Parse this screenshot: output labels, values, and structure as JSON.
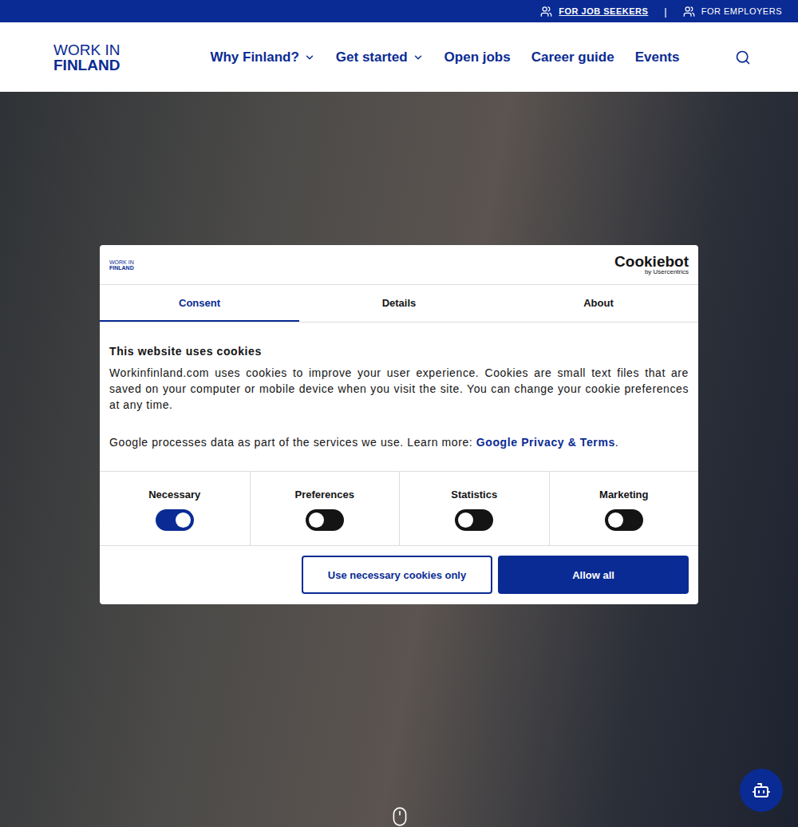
{
  "topbar": {
    "links": [
      {
        "label": "FOR JOB SEEKERS",
        "selected": true
      },
      {
        "label": "FOR EMPLOYERS",
        "selected": false
      }
    ],
    "separator": "|"
  },
  "header": {
    "logo": [
      "WORK IN",
      "FINLAND"
    ],
    "nav": [
      {
        "label": "Why Finland?",
        "dropdown": true
      },
      {
        "label": "Get started",
        "dropdown": true
      },
      {
        "label": "Open jobs",
        "dropdown": false
      },
      {
        "label": "Career guide",
        "dropdown": false
      },
      {
        "label": "Events",
        "dropdown": false
      }
    ]
  },
  "cookie_dialog": {
    "logo": [
      "WORK IN",
      "FINLAND"
    ],
    "brand": {
      "name": "Cookiebot",
      "by": "by Usercentrics"
    },
    "tabs": [
      {
        "label": "Consent",
        "selected": true
      },
      {
        "label": "Details",
        "selected": false
      },
      {
        "label": "About",
        "selected": false
      }
    ],
    "title": "This website uses cookies",
    "paragraph": "Workinfinland.com uses cookies to improve your user experience. Cookies are small text files that are saved on your computer or mobile device when you visit the site. You can change your cookie preferences at any time.",
    "google": {
      "text": "Google processes data as part of the services we use. Learn more: ",
      "link": "Google Privacy & Terms",
      "after": "."
    },
    "toggles": [
      {
        "label": "Necessary",
        "on": true
      },
      {
        "label": "Preferences",
        "on": false
      },
      {
        "label": "Statistics",
        "on": false
      },
      {
        "label": "Marketing",
        "on": false
      }
    ],
    "buttons": [
      {
        "label": "Use necessary cookies only",
        "kind": "outline"
      },
      {
        "label": "Allow all",
        "kind": "primary"
      }
    ]
  }
}
